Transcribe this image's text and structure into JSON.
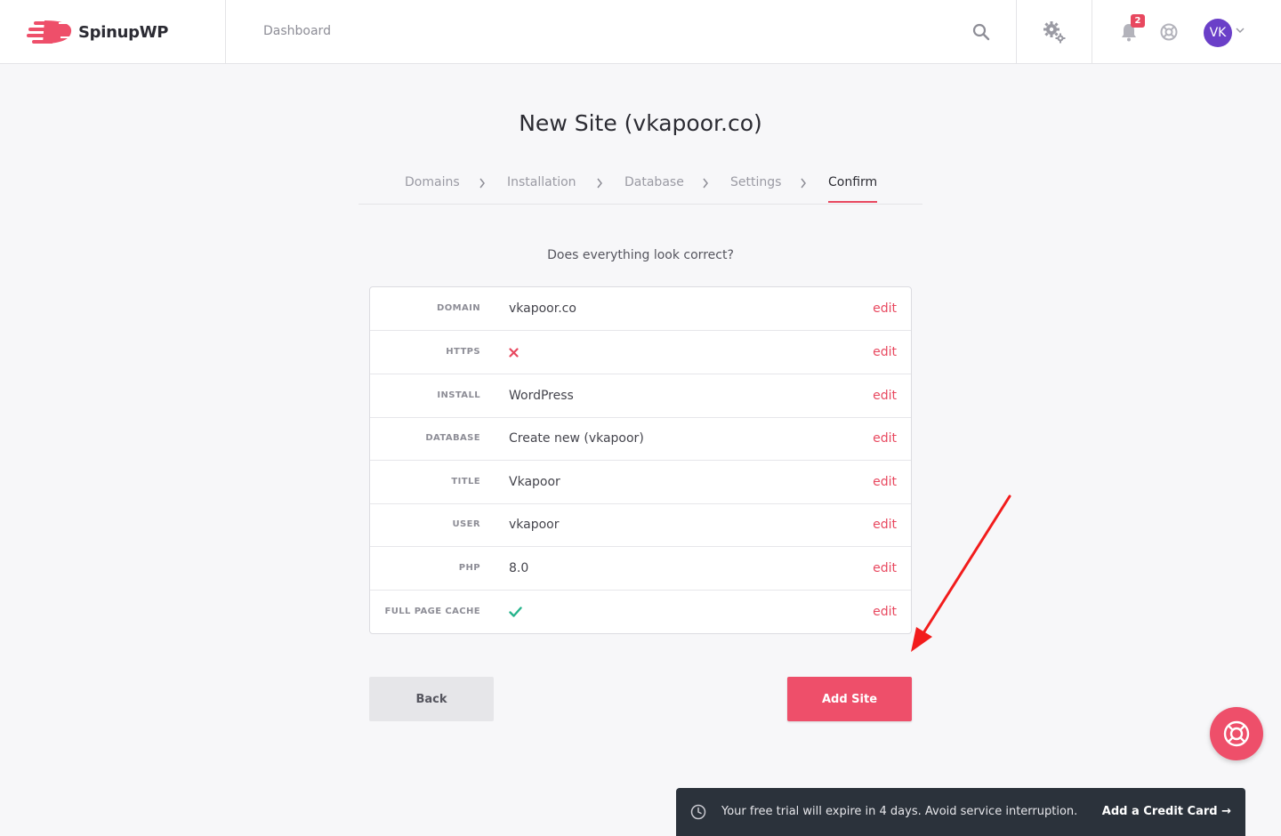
{
  "header": {
    "brand": "SpinupWP",
    "nav_dashboard": "Dashboard",
    "notification_count": "2",
    "avatar_initials": "VK",
    "accent_color": "#e8485f",
    "avatar_color": "#6a3fc8",
    "icons": [
      "search-icon",
      "gear-icon",
      "bell-icon",
      "globe-icon",
      "chevron-down-icon"
    ]
  },
  "page": {
    "title": "New Site (vkapoor.co)",
    "question": "Does everything look correct?"
  },
  "steps": [
    {
      "label": "Domains",
      "active": false
    },
    {
      "label": "Installation",
      "active": false
    },
    {
      "label": "Database",
      "active": false
    },
    {
      "label": "Settings",
      "active": false
    },
    {
      "label": "Confirm",
      "active": true
    }
  ],
  "summary": {
    "edit_label": "edit",
    "rows": [
      {
        "label": "DOMAIN",
        "value": "vkapoor.co"
      },
      {
        "label": "HTTPS",
        "value": "",
        "icon": "cross-icon"
      },
      {
        "label": "INSTALL",
        "value": "WordPress"
      },
      {
        "label": "DATABASE",
        "value": "Create new (vkapoor)"
      },
      {
        "label": "TITLE",
        "value": "Vkapoor"
      },
      {
        "label": "USER",
        "value": "vkapoor"
      },
      {
        "label": "PHP",
        "value": "8.0"
      },
      {
        "label": "FULL PAGE CACHE",
        "value": "",
        "icon": "check-icon"
      }
    ]
  },
  "actions": {
    "back_label": "Back",
    "add_site_label": "Add Site"
  },
  "trial_banner": {
    "message": "Your free trial will expire in 4 days. Avoid service interruption.",
    "link_label": "Add a Credit Card →"
  }
}
